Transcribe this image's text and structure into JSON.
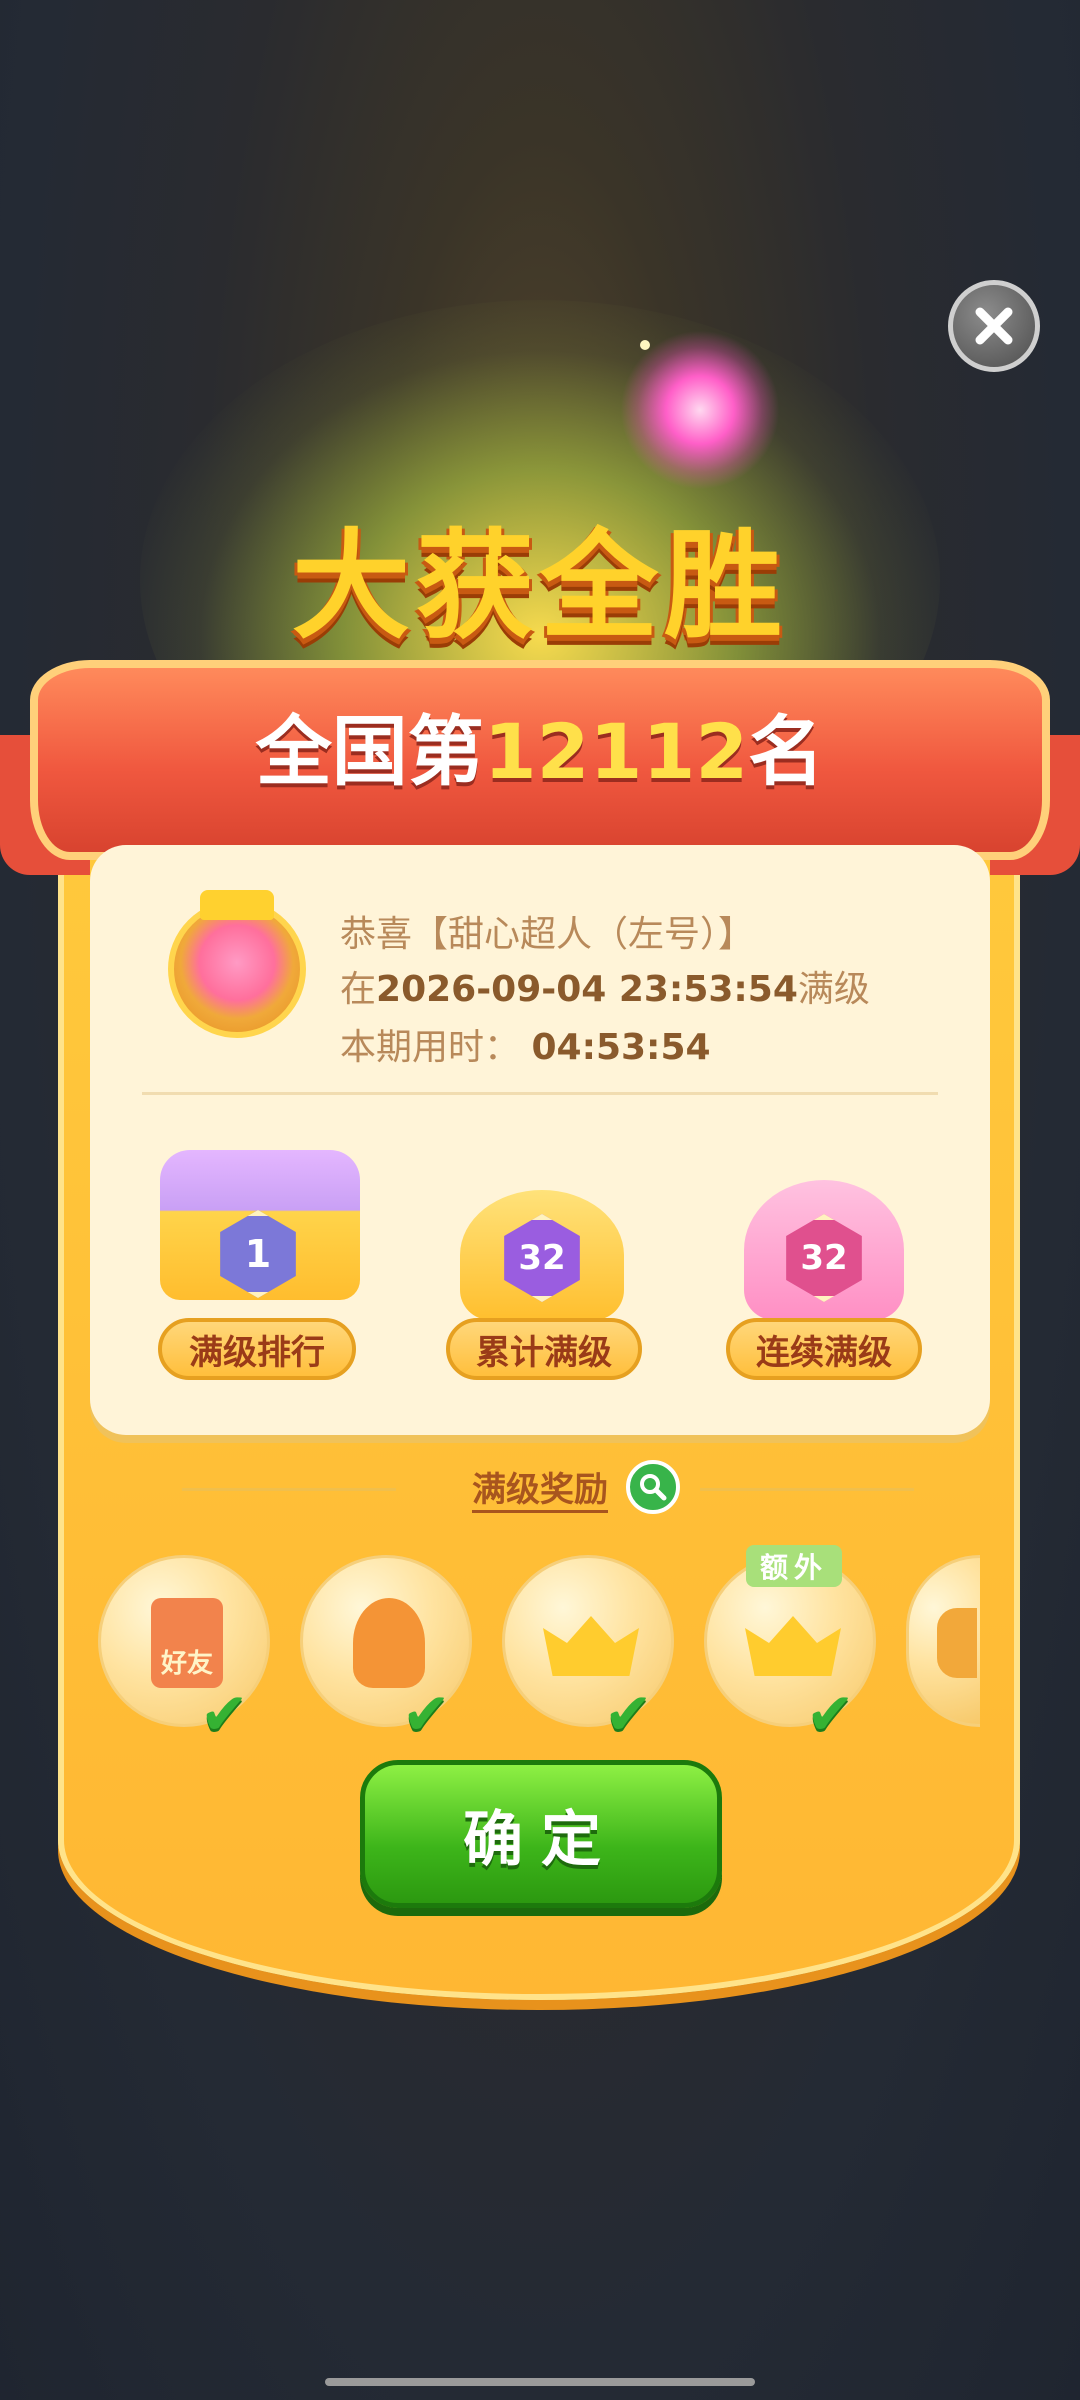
{
  "title": "大获全胜",
  "rank": {
    "prefix": "全国第",
    "number": "12112",
    "suffix": "名"
  },
  "info": {
    "line1": "恭喜【甜心超人（左号）】",
    "line2_prefix": "在",
    "datetime": "2026-09-04 23:53:54",
    "line2_suffix": "满级",
    "time_label": "本期用时：",
    "time_value": "04:53:54"
  },
  "badges": [
    {
      "value": "1",
      "label": "满级排行"
    },
    {
      "value": "32",
      "label": "累计满级"
    },
    {
      "value": "32",
      "label": "连续满级"
    }
  ],
  "rewards": {
    "title": "满级奖励",
    "items": [
      {
        "icon": "red-envelope-icon",
        "text": "好友",
        "claimed": true
      },
      {
        "icon": "trophy-icon",
        "text": "",
        "claimed": true
      },
      {
        "icon": "crown-icon",
        "text": "",
        "claimed": true
      },
      {
        "icon": "crown-icon",
        "text": "",
        "claimed": true,
        "tag": "额外"
      },
      {
        "icon": "badge-icon",
        "text": "",
        "claimed": false
      }
    ]
  },
  "confirm_label": "确定",
  "colors": {
    "accent_green": "#3db51a",
    "ribbon": "#f0583f",
    "panel": "#ffbf3c"
  }
}
